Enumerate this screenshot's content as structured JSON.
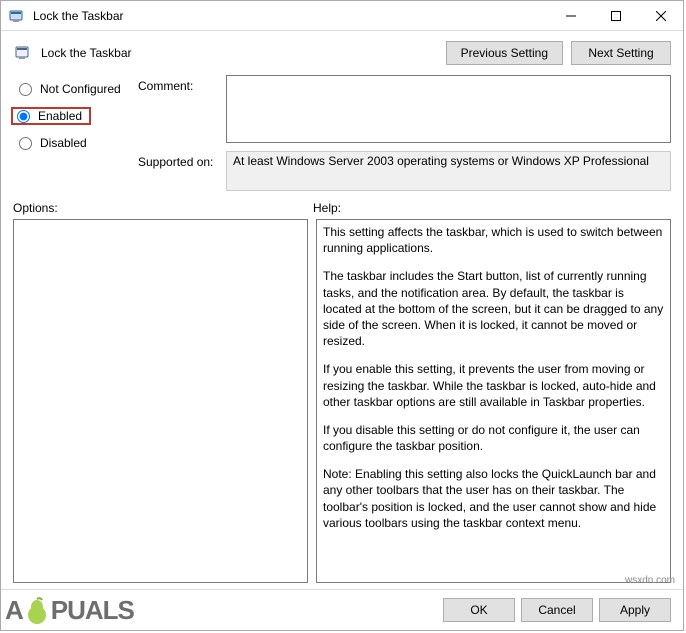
{
  "window": {
    "title": "Lock the Taskbar"
  },
  "header": {
    "policy_name": "Lock the Taskbar",
    "prev_btn": "Previous Setting",
    "next_btn": "Next Setting"
  },
  "state": {
    "not_configured": "Not Configured",
    "enabled": "Enabled",
    "disabled": "Disabled",
    "selected": "enabled"
  },
  "labels": {
    "comment": "Comment:",
    "supported": "Supported on:",
    "options": "Options:",
    "help": "Help:"
  },
  "fields": {
    "comment": "",
    "supported_on": "At least Windows Server 2003 operating systems or Windows XP Professional"
  },
  "help": {
    "p1": "This setting affects the taskbar, which is used to switch between running applications.",
    "p2": "The taskbar includes the Start button, list of currently running tasks, and the notification area. By default, the taskbar is located at the bottom of the screen, but it can be dragged to any side of the screen. When it is locked, it cannot be moved or resized.",
    "p3": "If you enable this setting, it prevents the user from moving or resizing the taskbar. While the taskbar is locked, auto-hide and other taskbar options are still available in Taskbar properties.",
    "p4": "If you disable this setting or do not configure it, the user can configure the taskbar position.",
    "p5": "Note: Enabling this setting also locks the QuickLaunch bar and any other toolbars that the user has on their taskbar. The toolbar's position is locked, and the user cannot show and hide various toolbars using the taskbar context menu."
  },
  "footer": {
    "ok": "OK",
    "cancel": "Cancel",
    "apply": "Apply"
  },
  "watermark": {
    "left_prefix": "A",
    "left_suffix": "PUALS",
    "right": "wsxdn.com"
  }
}
